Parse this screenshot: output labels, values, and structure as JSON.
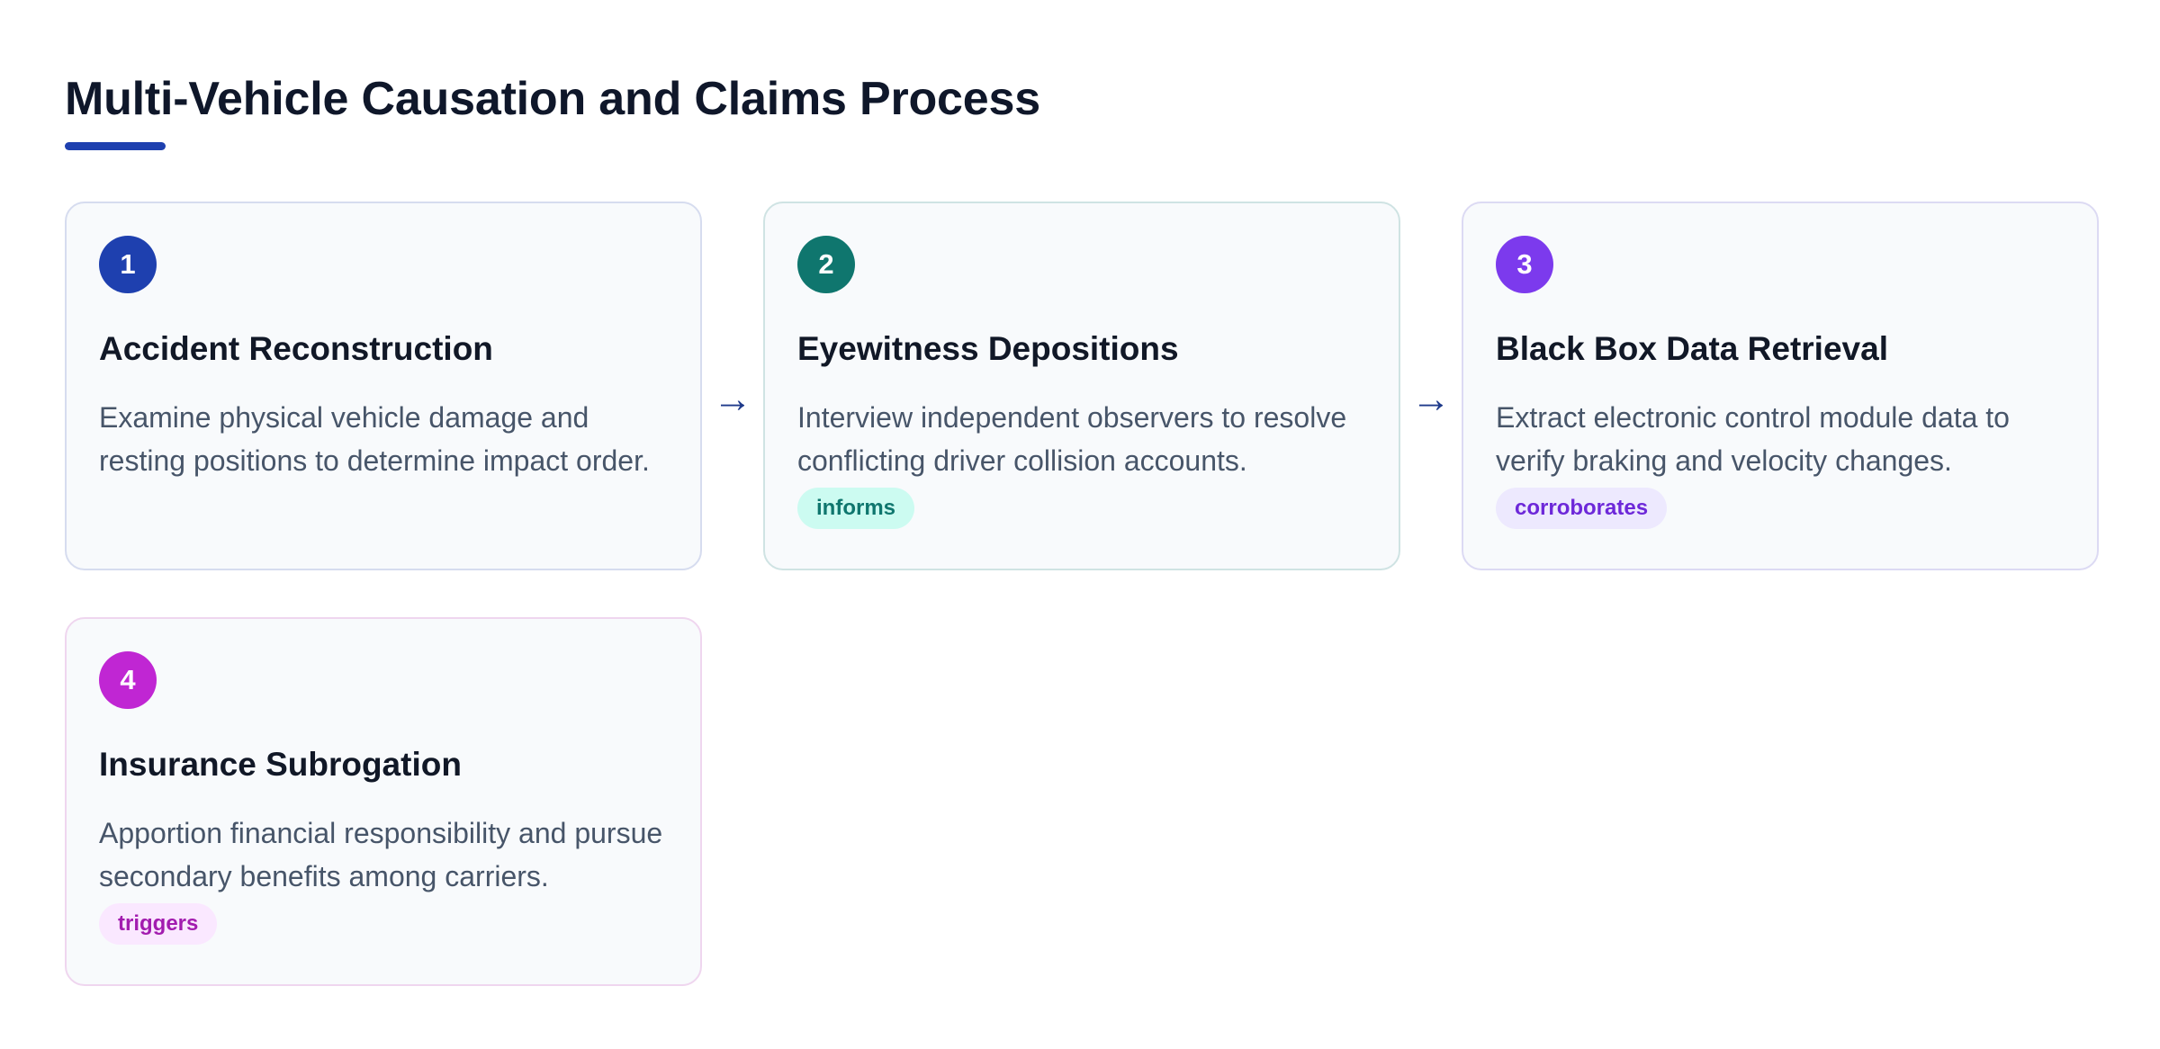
{
  "title": "Multi-Vehicle Causation and Claims Process",
  "colors": {
    "title_accent": "#1e40af",
    "step1": "#1e40af",
    "step2": "#0f766e",
    "step3": "#7c3aed",
    "step4": "#c026d3"
  },
  "steps": [
    {
      "number": "1",
      "title": "Accident Reconstruction",
      "description": "Examine physical vehicle damage and resting positions to determine impact order.",
      "tag": "",
      "accent": "#1e40af"
    },
    {
      "number": "2",
      "title": "Eyewitness Depositions",
      "description": "Interview independent observers to resolve conflicting driver collision accounts.",
      "tag": "informs",
      "accent": "#0f766e",
      "tag_bg": "#ccfbf1",
      "tag_color": "#0f766e"
    },
    {
      "number": "3",
      "title": "Black Box Data Retrieval",
      "description": "Extract electronic control module data to verify braking and velocity changes.",
      "tag": "corroborates",
      "accent": "#7c3aed",
      "tag_bg": "#ede9fe",
      "tag_color": "#6d28d9"
    },
    {
      "number": "4",
      "title": "Insurance Subrogation",
      "description": "Apportion financial responsibility and pursue secondary benefits among carriers.",
      "tag": "triggers",
      "accent": "#c026d3",
      "tag_bg": "#fae8ff",
      "tag_color": "#a21caf"
    }
  ],
  "connectors": [
    "→",
    "→"
  ]
}
